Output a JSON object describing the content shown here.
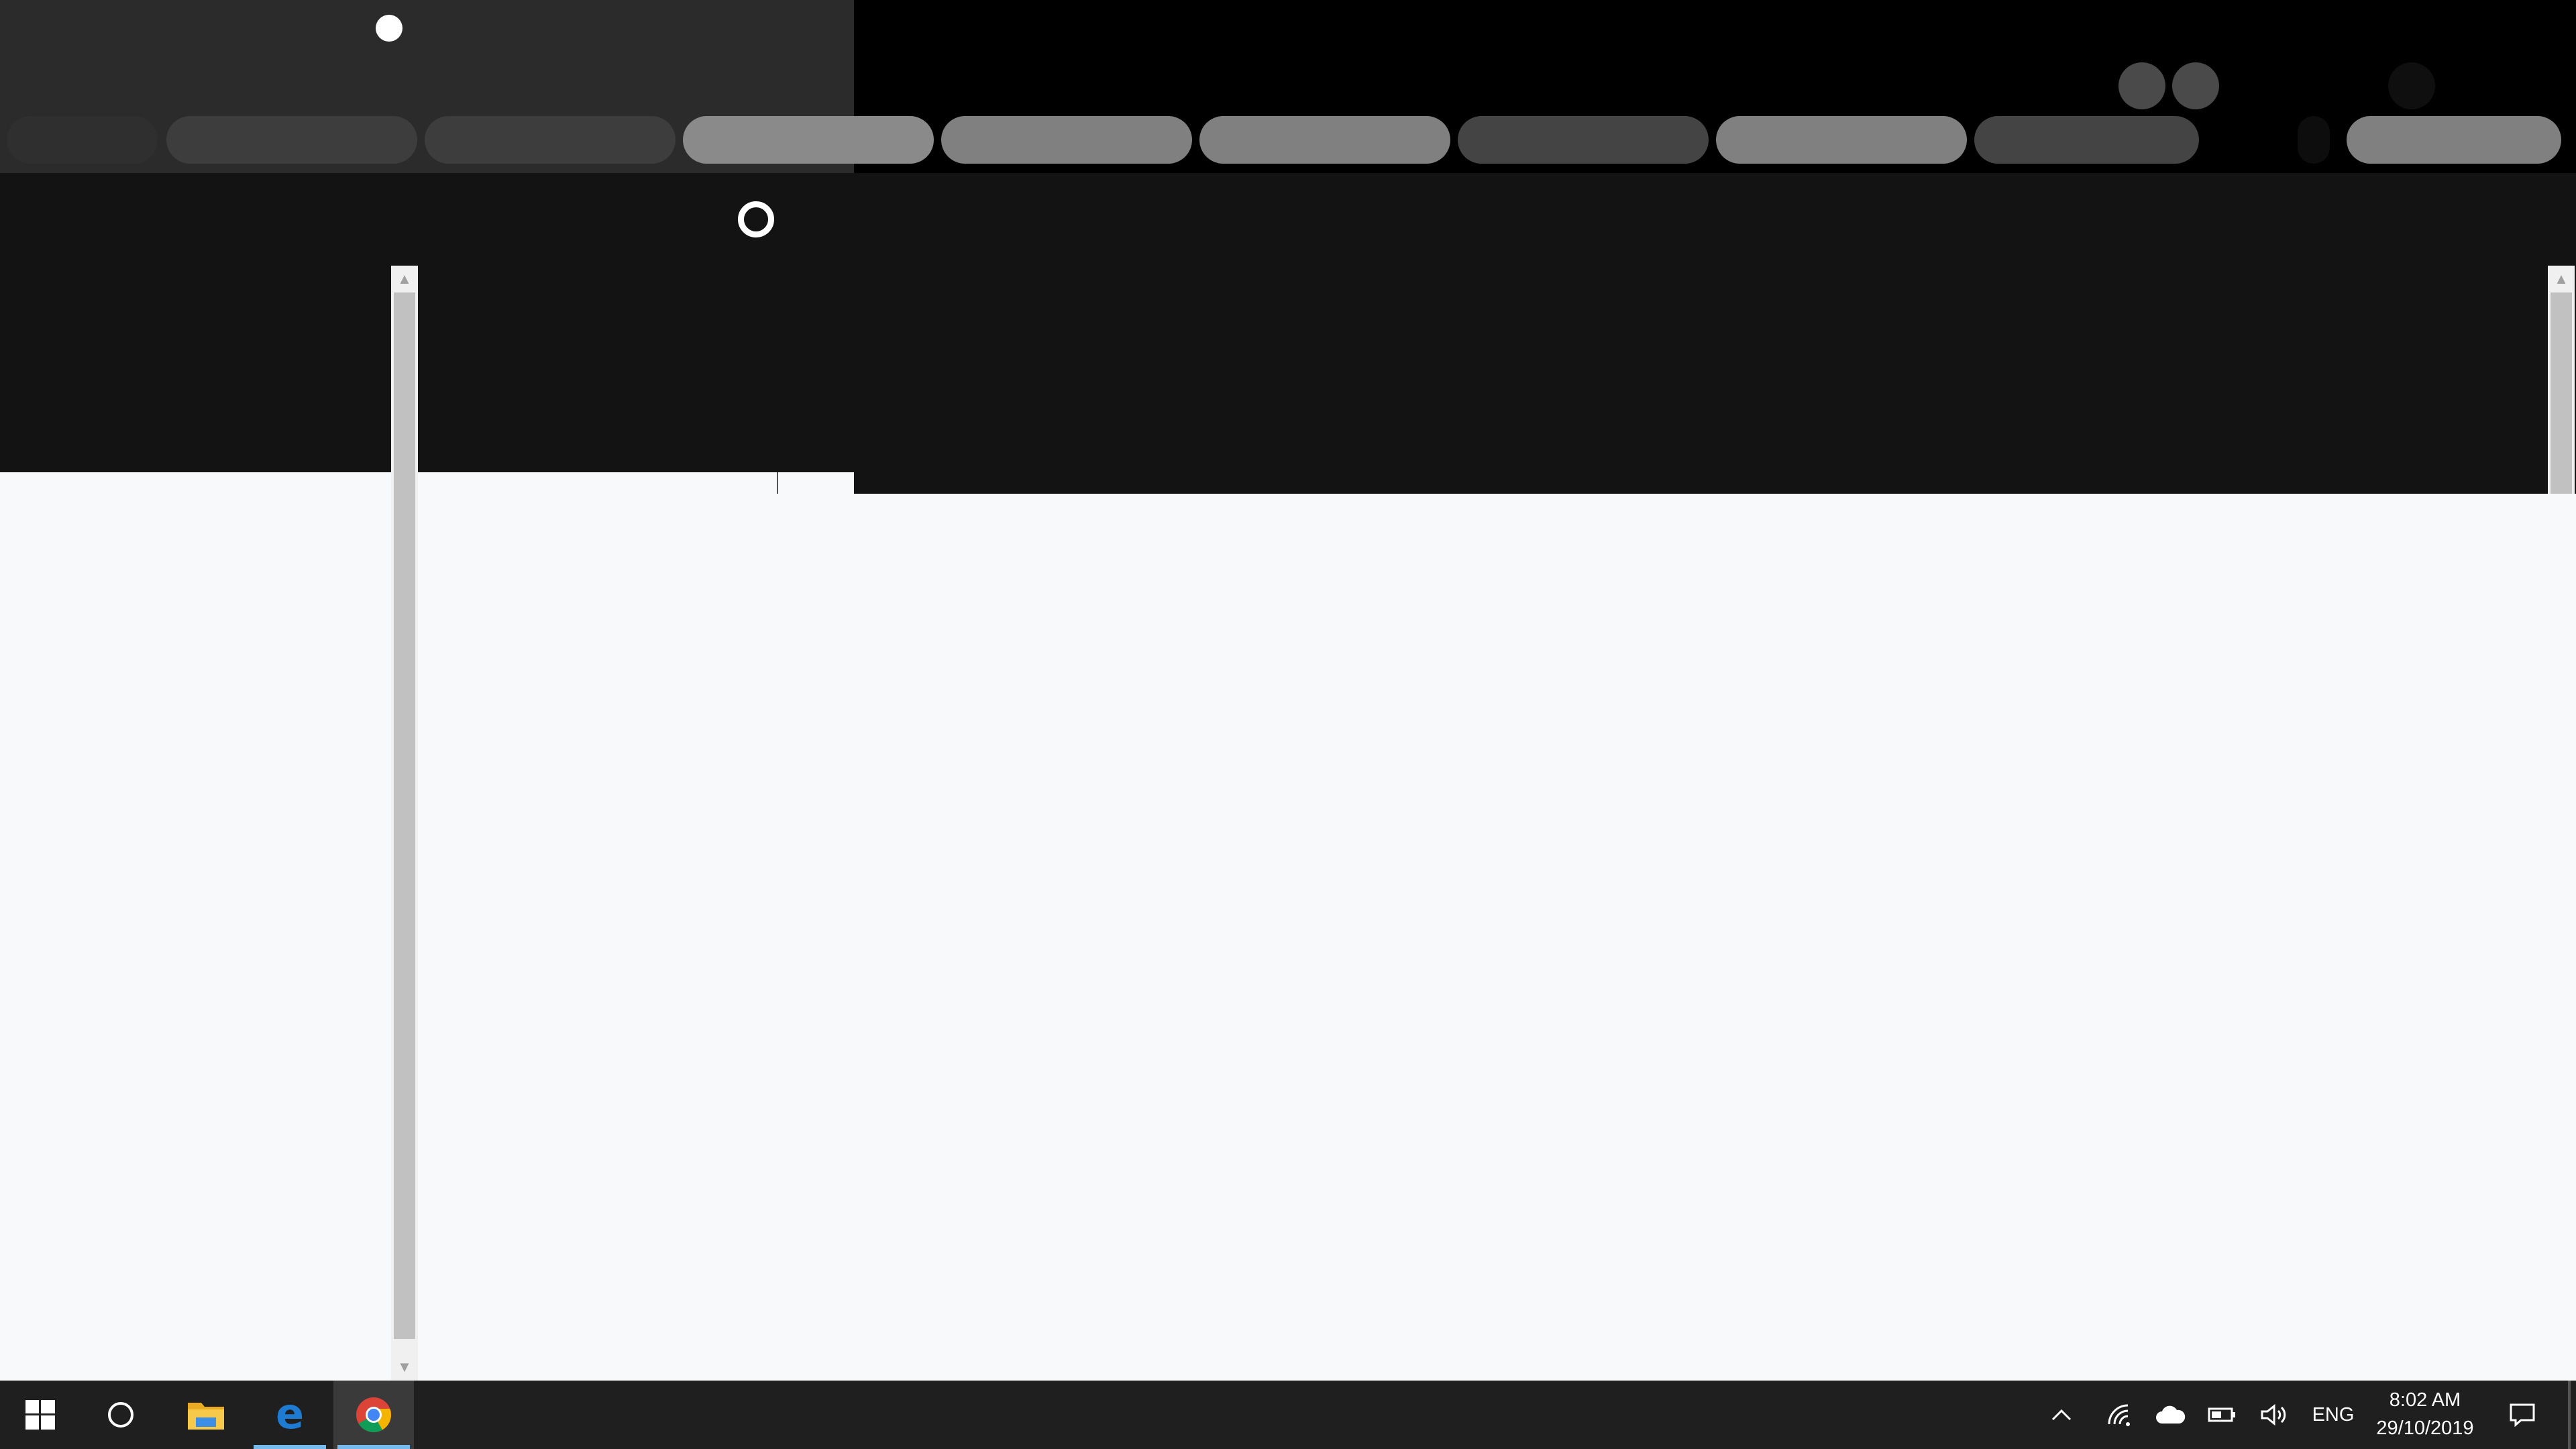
{
  "top_tabs": [
    {
      "name": "tab-1",
      "shade": "dark"
    },
    {
      "name": "tab-2",
      "shade": "dark"
    },
    {
      "name": "tab-3",
      "shade": "dark"
    },
    {
      "name": "tab-4",
      "shade": "light"
    },
    {
      "name": "tab-5",
      "shade": "light"
    },
    {
      "name": "tab-6",
      "shade": "light"
    },
    {
      "name": "tab-7",
      "shade": "mid"
    },
    {
      "name": "tab-8",
      "shade": "light"
    },
    {
      "name": "tab-9",
      "shade": "mid"
    },
    {
      "name": "tab-10",
      "shade": "light"
    }
  ],
  "taskbar": {
    "apps": [
      {
        "name": "start-button",
        "icon": "windows-logo-icon"
      },
      {
        "name": "cortana-button",
        "icon": "cortana-circle-icon"
      },
      {
        "name": "file-explorer-button",
        "icon": "folder-icon"
      },
      {
        "name": "edge-button",
        "icon": "edge-icon",
        "running": true
      },
      {
        "name": "chrome-button",
        "icon": "chrome-icon",
        "active": true
      }
    ],
    "tray": {
      "language": "ENG",
      "time": "8:02 AM",
      "date": "29/10/2019"
    }
  },
  "colors": {
    "accent": "#76b9ed",
    "edge_blue": "#1e7bd2",
    "folder_yellow": "#f7c94b",
    "background_light": "#f8f9fa",
    "background_dark": "#131313"
  }
}
